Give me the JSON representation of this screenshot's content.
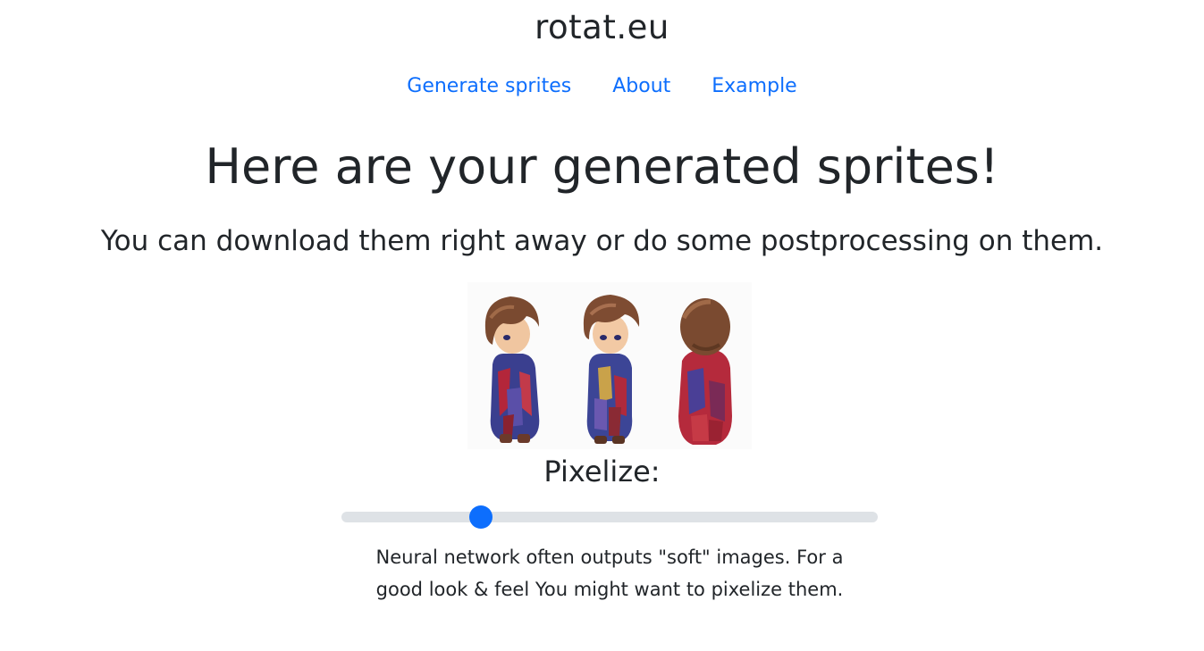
{
  "brand": "rotat.eu",
  "nav": {
    "items": [
      {
        "label": "Generate sprites"
      },
      {
        "label": "About"
      },
      {
        "label": "Example"
      }
    ]
  },
  "main": {
    "heading": "Here are your generated sprites!",
    "subheading": "You can download them right away or do some postprocessing on them.",
    "sprites": [
      {
        "view": "front"
      },
      {
        "view": "side"
      },
      {
        "view": "back"
      }
    ],
    "pixelize": {
      "label": "Pixelize:",
      "value_fraction": 0.26
    },
    "note": "Neural network often outputs \"soft\" images. For a good look & feel You might want to pixelize them."
  },
  "colors": {
    "link": "#0d6efd",
    "slider_track": "#dee2e6",
    "slider_thumb": "#0d6efd",
    "text": "#212529"
  }
}
